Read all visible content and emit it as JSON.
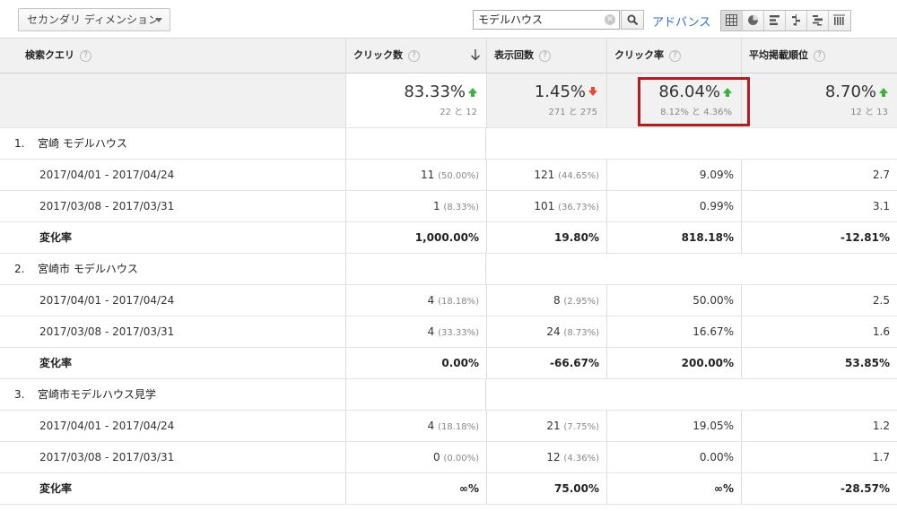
{
  "toolbar": {
    "dimension_label": "セカンダリ ディメンション",
    "search_value": "モデルハウス",
    "advanced_label": "アドバンス",
    "view_icons": [
      "table-view-icon",
      "pie-view-icon",
      "performance-view-icon",
      "comparison-view-icon",
      "term-cloud-view-icon",
      "pivot-view-icon"
    ]
  },
  "header": {
    "query": "検索クエリ",
    "clicks": "クリック数",
    "impressions": "表示回数",
    "ctr": "クリック率",
    "position": "平均掲載順位",
    "help_glyph": "?"
  },
  "totals": {
    "clicks": {
      "value": "83.33%",
      "sub": "22 と 12",
      "trend": "up"
    },
    "impressions": {
      "value": "1.45%",
      "sub": "271 と 275",
      "trend": "down"
    },
    "ctr": {
      "value": "86.04%",
      "sub": "8.12% と 4.36%",
      "trend": "up"
    },
    "position": {
      "value": "8.70%",
      "sub": "12 と 13",
      "trend": "up"
    }
  },
  "groups": [
    {
      "index": "1.",
      "query": "宮崎 モデルハウス",
      "rows": [
        {
          "label": "2017/04/01 - 2017/04/24",
          "clicks": "11",
          "clicks_pct": "(50.00%)",
          "impr": "121",
          "impr_pct": "(44.65%)",
          "ctr": "9.09%",
          "pos": "2.7"
        },
        {
          "label": "2017/03/08 - 2017/03/31",
          "clicks": "1",
          "clicks_pct": "(8.33%)",
          "impr": "101",
          "impr_pct": "(36.73%)",
          "ctr": "0.99%",
          "pos": "3.1"
        }
      ],
      "change": {
        "label": "変化率",
        "clicks": "1,000.00%",
        "impr": "19.80%",
        "ctr": "818.18%",
        "pos": "-12.81%"
      }
    },
    {
      "index": "2.",
      "query": "宮崎市 モデルハウス",
      "rows": [
        {
          "label": "2017/04/01 - 2017/04/24",
          "clicks": "4",
          "clicks_pct": "(18.18%)",
          "impr": "8",
          "impr_pct": "(2.95%)",
          "ctr": "50.00%",
          "pos": "2.5"
        },
        {
          "label": "2017/03/08 - 2017/03/31",
          "clicks": "4",
          "clicks_pct": "(33.33%)",
          "impr": "24",
          "impr_pct": "(8.73%)",
          "ctr": "16.67%",
          "pos": "1.6"
        }
      ],
      "change": {
        "label": "変化率",
        "clicks": "0.00%",
        "impr": "-66.67%",
        "ctr": "200.00%",
        "pos": "53.85%"
      }
    },
    {
      "index": "3.",
      "query": "宮崎市モデルハウス見学",
      "rows": [
        {
          "label": "2017/04/01 - 2017/04/24",
          "clicks": "4",
          "clicks_pct": "(18.18%)",
          "impr": "21",
          "impr_pct": "(7.75%)",
          "ctr": "19.05%",
          "pos": "1.2"
        },
        {
          "label": "2017/03/08 - 2017/03/31",
          "clicks": "0",
          "clicks_pct": "(0.00%)",
          "impr": "12",
          "impr_pct": "(4.36%)",
          "ctr": "0.00%",
          "pos": "1.7"
        }
      ],
      "change": {
        "label": "変化率",
        "clicks": "∞%",
        "impr": "75.00%",
        "ctr": "∞%",
        "pos": "-28.57%"
      }
    }
  ]
}
